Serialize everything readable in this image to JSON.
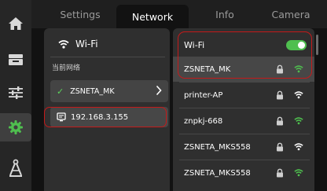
{
  "sidebar": {
    "items": [
      {
        "icon": "home-icon",
        "active": false
      },
      {
        "icon": "printer-tray-icon",
        "active": false
      },
      {
        "icon": "sliders-icon",
        "active": false
      },
      {
        "icon": "gear-icon",
        "active": true
      },
      {
        "icon": "calipers-icon",
        "active": false
      }
    ]
  },
  "tabs": [
    "Settings",
    "Network",
    "Info",
    "Camera"
  ],
  "active_tab": "Network",
  "left_panel": {
    "wifi_label": "Wi-Fi",
    "current_network_label": "当前网络",
    "current_network_name": "ZSNETA_MK",
    "ip_address": "192.168.3.155"
  },
  "right_panel": {
    "wifi_label": "Wi-Fi",
    "wifi_enabled": true,
    "networks": [
      {
        "name": "ZSNETA_MK",
        "locked": true,
        "signal_color": "#4fbf4f",
        "selected": true
      },
      {
        "name": "printer-AP",
        "locked": true,
        "signal_color": "#ffffff",
        "selected": false
      },
      {
        "name": "znpkj-668",
        "locked": true,
        "signal_color": "#4fbf4f",
        "selected": false
      },
      {
        "name": "ZSNETA_MKS558",
        "locked": true,
        "signal_color": "#ffffff",
        "selected": false
      },
      {
        "name": "ZSNETA_MKS558",
        "locked": true,
        "signal_color": "#4fbf4f",
        "selected": false
      }
    ]
  },
  "colors": {
    "accent_green": "#4fbf4f",
    "highlight_red": "#c41a1a",
    "sidebar_bg": "#262626",
    "panel_bg": "#2f2f2f"
  }
}
